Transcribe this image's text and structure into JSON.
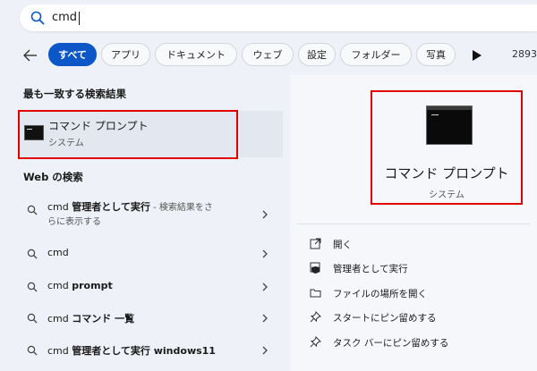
{
  "search": {
    "query": "cmd"
  },
  "filters": {
    "items": [
      "すべて",
      "アプリ",
      "ドキュメント",
      "ウェブ",
      "設定",
      "フォルダー",
      "写真"
    ],
    "count": "2893"
  },
  "best_match": {
    "header": "最も一致する検索結果",
    "title": "コマンド プロンプト",
    "subtitle": "システム"
  },
  "web": {
    "header": "Web の検索",
    "results": [
      {
        "pre": "cmd ",
        "bold": "管理者として実行",
        "desc": " - 検索結果をさ",
        "line2": "らに表示する"
      },
      {
        "pre": "cmd",
        "bold": "",
        "desc": "",
        "line2": ""
      },
      {
        "pre": "cmd ",
        "bold": "prompt",
        "desc": "",
        "line2": ""
      },
      {
        "pre": "cmd ",
        "bold": "コマンド 一覧",
        "desc": "",
        "line2": ""
      },
      {
        "pre": "cmd ",
        "bold": "管理者として実行 windows11",
        "desc": "",
        "line2": ""
      }
    ]
  },
  "detail": {
    "title": "コマンド プロンプト",
    "subtitle": "システム",
    "actions": [
      {
        "label": "開く",
        "icon": "open-icon"
      },
      {
        "label": "管理者として実行",
        "icon": "shield-icon"
      },
      {
        "label": "ファイルの場所を開く",
        "icon": "folder-icon"
      },
      {
        "label": "スタートにピン留めする",
        "icon": "pin-icon"
      },
      {
        "label": "タスク バーにピン留めする",
        "icon": "pin-icon"
      }
    ]
  },
  "colors": {
    "accent": "#0b57c8",
    "highlight_box": "#e00000"
  }
}
